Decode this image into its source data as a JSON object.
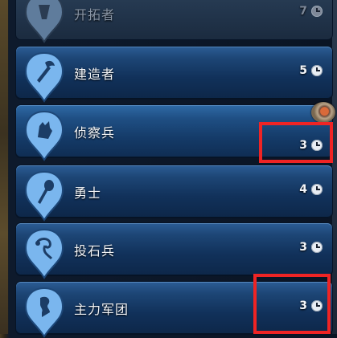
{
  "units": [
    {
      "name": "开拓者",
      "turns": "7",
      "icon": "settler-icon",
      "state": "disabled"
    },
    {
      "name": "建造者",
      "turns": "5",
      "icon": "builder-icon",
      "state": "normal"
    },
    {
      "name": "侦察兵",
      "turns": "3",
      "icon": "scout-icon",
      "state": "selected",
      "promo_badge": "recommended-advisor-icon"
    },
    {
      "name": "勇士",
      "turns": "4",
      "icon": "warrior-icon",
      "state": "normal"
    },
    {
      "name": "投石兵",
      "turns": "3",
      "icon": "slinger-icon",
      "state": "normal"
    },
    {
      "name": "主力军团",
      "turns": "3",
      "icon": "corps-icon",
      "state": "normal"
    }
  ],
  "colors": {
    "row_top": "#2c5d95",
    "row_bottom": "#0d2749",
    "badge_fill": "#7ab6ee",
    "highlight": "#ef2424"
  }
}
